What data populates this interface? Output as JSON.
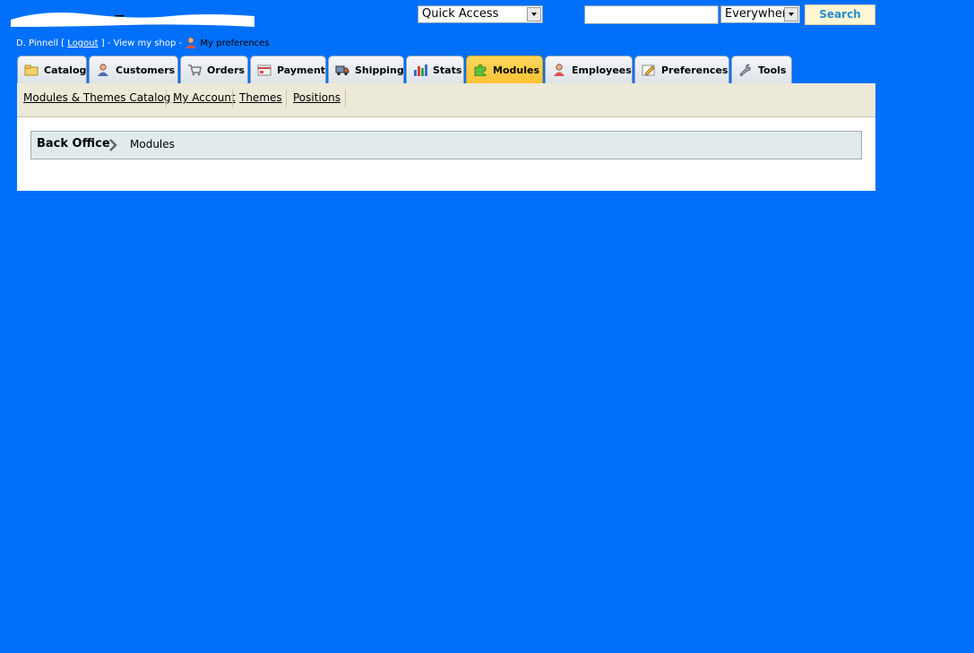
{
  "header": {
    "user_name": "D. Pinnell",
    "logout_open": " [ ",
    "logout_label": "Logout",
    "logout_close": " ] - ",
    "view_shop_label": "View my shop",
    "separator": " - ",
    "preferences_label": "My preferences",
    "quick_access": {
      "selected": "Quick Access"
    },
    "search": {
      "value": "",
      "scope_selected": "Everywhere",
      "button_label": "Search"
    }
  },
  "tabs": [
    {
      "label": "Catalog",
      "icon": "folder-icon",
      "active": false
    },
    {
      "label": "Customers",
      "icon": "customer-icon",
      "active": false
    },
    {
      "label": "Orders",
      "icon": "cart-icon",
      "active": false
    },
    {
      "label": "Payment",
      "icon": "payment-icon",
      "active": false
    },
    {
      "label": "Shipping",
      "icon": "truck-icon",
      "active": false
    },
    {
      "label": "Stats",
      "icon": "bar-chart-icon",
      "active": false
    },
    {
      "label": "Modules",
      "icon": "puzzle-icon",
      "active": true
    },
    {
      "label": "Employees",
      "icon": "employee-icon",
      "active": false
    },
    {
      "label": "Preferences",
      "icon": "preferences-icon",
      "active": false
    },
    {
      "label": "Tools",
      "icon": "wrench-icon",
      "active": false
    }
  ],
  "subnav": [
    {
      "label": "Modules & Themes Catalog"
    },
    {
      "label": "My Account"
    },
    {
      "label": "Themes"
    },
    {
      "label": "Positions"
    }
  ],
  "breadcrumb": {
    "root": "Back Office",
    "current": "Modules"
  },
  "colors": {
    "page_background": "#0070fa",
    "active_tab": "#f9c233",
    "search_text": "#268ccd"
  }
}
